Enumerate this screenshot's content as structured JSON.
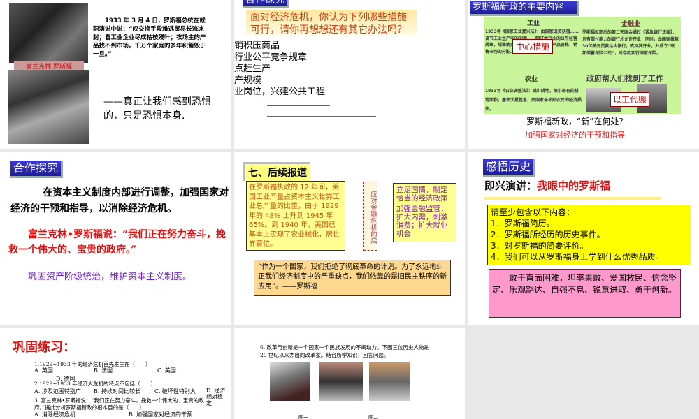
{
  "slide1": {
    "photo_caption": "富兰克林·罗斯福",
    "quote_text": "1933 年 3 月 4 日，罗斯福总统在就职演说中说：“叹交换手段难逃贸易长流冰封；看工业企业尽成枯枝残叶；农场主的产品找不到市场，千万个家庭的多年积蓄毁于一旦。”",
    "fear_quote": "——真正让我们感到恐惧的，只是恐惧本身."
  },
  "slide2": {
    "title": "合作探究",
    "question": "面对经济危机，你认为下列哪些措施可行，请你再想想还有其它办法吗？",
    "options": [
      "销积压商品",
      "行业公平竞争规章",
      "点赶生产",
      "产规模",
      "业岗位，兴建公共工程"
    ]
  },
  "slide3": {
    "title": "罗斯福新政的主要内容",
    "industry": {
      "heading": "工业",
      "text": "1933年《国家工业复兴法》：由国家出资扶植……调节工业生产中的问题……制订本行业的公平经营规章，规章确定各企业的生产规模、产品价格、销售市场的分配……",
      "badge": "中心措施"
    },
    "finance": {
      "heading": "金融业",
      "text": "罗斯福就职后的第二天国会通过《紧急银行法案》：凡有偿付能力的银行才允许开业，同时，由国家拨款30亿美元贷款给大银行，支持其开业，并成立“联邦储蓄保险公司”，对存款实行国家保险。"
    },
    "agriculture": {
      "heading": "农业",
      "text": "1933年《农业调整法》：减少耕地，缩小现有的耕地面积，屠宰大批牲畜，由国家来补贴农民的经济损失。"
    },
    "jobs": {
      "heading": "政府帮人们找到了工作",
      "badge": "以工代赈"
    },
    "question": "罗斯福新政，“新”在何处?",
    "answer": "加强国家对经济的干预和指导"
  },
  "slide4": {
    "title": "合作探究",
    "para1": "在资本主义制度内部进行调整，加强国家对经济的干预和指导，以消除经济危机。",
    "para2": "富兰克林•罗斯福说：“我们正在努力奋斗，挽救一个伟大的、宝贵的政府。”",
    "para3": "巩固资产阶级统治，维护资本主义制度。"
  },
  "slide5": {
    "title": "七、后续报道",
    "left_box": "在罗斯福执政的 12 年间，美国工业产量占资本主义世界工业总产量的比重，由于 1929 年的 48% 上升到 1945 年 65%。到 1940 年，美国已基本上实现了农业械化，居世界首位。",
    "vertical_label": "应对金融危机的启",
    "right_title": "立足国情，制定恰当的经济政策",
    "right_body": "加强金融监管；扩大内需，刺激消费；扩大就业机会",
    "quote": "“作为一个国家，我们拒绝了彻底革命的计划。为了永远地纠正我们经济制度中的严重缺点，我们依靠的是旧民主秩序的新应用”。——罗斯福"
  },
  "slide6": {
    "title": "感悟历史",
    "heading_label": "即兴演讲：",
    "heading_topic": "我眼中的罗斯福",
    "list_intro": "请至少包含以下内容：",
    "list": [
      "1．罗斯福简历。",
      "2．罗斯福所经历的历史事件。",
      "3．对罗斯福的简要评价。",
      "4．我们可以从罗斯福身上学到什么优秀品质。"
    ],
    "qualities": "敢于直面困难，坦率果敢、爱国救民、信念坚定、乐观豁达、自强不息、锐意进取、勇于创新。"
  },
  "slide7": {
    "title": "巩固练习：",
    "q1": "1.1929~1933 年的经济危机首先发生在（　　）",
    "q1_opts": [
      "A. 英国",
      "B. 法国",
      "C. 美国",
      "D. 德国"
    ],
    "q2": "2.1929~1933 年经济大危机的特点不包括（　　）",
    "q2_opts": [
      "A. 涉及范围特别广",
      "B. 持续时间比较长",
      "C. 破坏性特别大",
      "D. 经济相对稳定"
    ],
    "q3": "3. 富兰克林•罗斯福说：“我们正在努力奋斗，挽救一个伟大的、宝贵的政府。”据此分析罗斯福新政的根本目的是（　　）",
    "q3_opts": [
      "A. 消除经济危机",
      "B. 加强国家对经济的干预"
    ]
  },
  "slide8": {
    "question": "6. 改革与创新是一个国家一个民族发展的不竭动力。下图三位历史人物是 20 世纪以来杰出的改革家。结合所学知识，回答问题。",
    "captions": [
      "图一",
      "图二"
    ]
  }
}
